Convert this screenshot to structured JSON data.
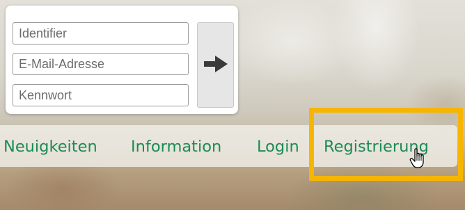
{
  "login": {
    "identifier_placeholder": "Identifier",
    "email_placeholder": "E-Mail-Adresse",
    "password_placeholder": "Kennwort",
    "submit_icon": "arrow-right-icon"
  },
  "nav": {
    "items": [
      {
        "label": "Neuigkeiten"
      },
      {
        "label": "Information"
      },
      {
        "label": "Login"
      },
      {
        "label": "Registrierung"
      }
    ],
    "highlighted": "Registrierung",
    "link_color": "#1c8a58"
  },
  "colors": {
    "highlight_box": "#f6b500",
    "submit_bg": "#e6e6e6",
    "arrow": "#3a3a3a"
  },
  "cursor": "hand-pointer-icon"
}
